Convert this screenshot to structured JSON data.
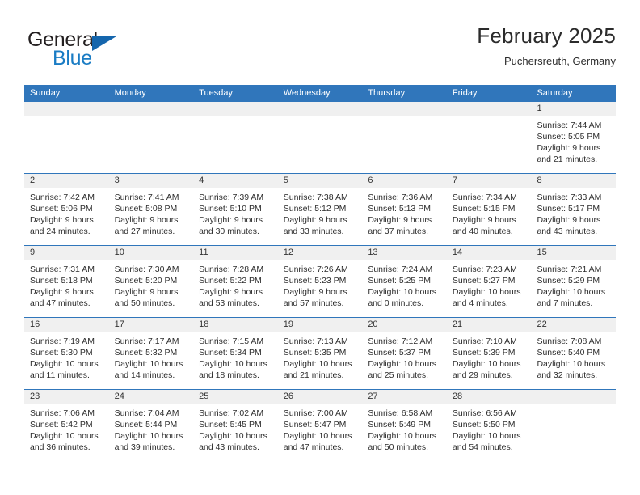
{
  "branding": {
    "name_part1": "General",
    "name_part2": "Blue",
    "triangle_icon": "brand-triangle-icon",
    "colors": {
      "dark": "#231f20",
      "blue": "#1a7cc4",
      "triangle": "#1566ad"
    }
  },
  "header": {
    "title": "February 2025",
    "subtitle": "Puchersreuth, Germany"
  },
  "theme": {
    "header_bg": "#3076bb",
    "header_text": "#ffffff",
    "day_band_bg": "#f0f0f0",
    "cell_bg": "#ffffff",
    "row_divider": "#3076bb"
  },
  "calendar": {
    "weekdays": [
      "Sunday",
      "Monday",
      "Tuesday",
      "Wednesday",
      "Thursday",
      "Friday",
      "Saturday"
    ],
    "weeks": [
      [
        {
          "day": "",
          "empty": true,
          "lines": []
        },
        {
          "day": "",
          "empty": true,
          "lines": []
        },
        {
          "day": "",
          "empty": true,
          "lines": []
        },
        {
          "day": "",
          "empty": true,
          "lines": []
        },
        {
          "day": "",
          "empty": true,
          "lines": []
        },
        {
          "day": "",
          "empty": true,
          "lines": []
        },
        {
          "day": "1",
          "empty": false,
          "lines": [
            "Sunrise: 7:44 AM",
            "Sunset: 5:05 PM",
            "Daylight: 9 hours",
            "and 21 minutes."
          ]
        }
      ],
      [
        {
          "day": "2",
          "empty": false,
          "lines": [
            "Sunrise: 7:42 AM",
            "Sunset: 5:06 PM",
            "Daylight: 9 hours",
            "and 24 minutes."
          ]
        },
        {
          "day": "3",
          "empty": false,
          "lines": [
            "Sunrise: 7:41 AM",
            "Sunset: 5:08 PM",
            "Daylight: 9 hours",
            "and 27 minutes."
          ]
        },
        {
          "day": "4",
          "empty": false,
          "lines": [
            "Sunrise: 7:39 AM",
            "Sunset: 5:10 PM",
            "Daylight: 9 hours",
            "and 30 minutes."
          ]
        },
        {
          "day": "5",
          "empty": false,
          "lines": [
            "Sunrise: 7:38 AM",
            "Sunset: 5:12 PM",
            "Daylight: 9 hours",
            "and 33 minutes."
          ]
        },
        {
          "day": "6",
          "empty": false,
          "lines": [
            "Sunrise: 7:36 AM",
            "Sunset: 5:13 PM",
            "Daylight: 9 hours",
            "and 37 minutes."
          ]
        },
        {
          "day": "7",
          "empty": false,
          "lines": [
            "Sunrise: 7:34 AM",
            "Sunset: 5:15 PM",
            "Daylight: 9 hours",
            "and 40 minutes."
          ]
        },
        {
          "day": "8",
          "empty": false,
          "lines": [
            "Sunrise: 7:33 AM",
            "Sunset: 5:17 PM",
            "Daylight: 9 hours",
            "and 43 minutes."
          ]
        }
      ],
      [
        {
          "day": "9",
          "empty": false,
          "lines": [
            "Sunrise: 7:31 AM",
            "Sunset: 5:18 PM",
            "Daylight: 9 hours",
            "and 47 minutes."
          ]
        },
        {
          "day": "10",
          "empty": false,
          "lines": [
            "Sunrise: 7:30 AM",
            "Sunset: 5:20 PM",
            "Daylight: 9 hours",
            "and 50 minutes."
          ]
        },
        {
          "day": "11",
          "empty": false,
          "lines": [
            "Sunrise: 7:28 AM",
            "Sunset: 5:22 PM",
            "Daylight: 9 hours",
            "and 53 minutes."
          ]
        },
        {
          "day": "12",
          "empty": false,
          "lines": [
            "Sunrise: 7:26 AM",
            "Sunset: 5:23 PM",
            "Daylight: 9 hours",
            "and 57 minutes."
          ]
        },
        {
          "day": "13",
          "empty": false,
          "lines": [
            "Sunrise: 7:24 AM",
            "Sunset: 5:25 PM",
            "Daylight: 10 hours",
            "and 0 minutes."
          ]
        },
        {
          "day": "14",
          "empty": false,
          "lines": [
            "Sunrise: 7:23 AM",
            "Sunset: 5:27 PM",
            "Daylight: 10 hours",
            "and 4 minutes."
          ]
        },
        {
          "day": "15",
          "empty": false,
          "lines": [
            "Sunrise: 7:21 AM",
            "Sunset: 5:29 PM",
            "Daylight: 10 hours",
            "and 7 minutes."
          ]
        }
      ],
      [
        {
          "day": "16",
          "empty": false,
          "lines": [
            "Sunrise: 7:19 AM",
            "Sunset: 5:30 PM",
            "Daylight: 10 hours",
            "and 11 minutes."
          ]
        },
        {
          "day": "17",
          "empty": false,
          "lines": [
            "Sunrise: 7:17 AM",
            "Sunset: 5:32 PM",
            "Daylight: 10 hours",
            "and 14 minutes."
          ]
        },
        {
          "day": "18",
          "empty": false,
          "lines": [
            "Sunrise: 7:15 AM",
            "Sunset: 5:34 PM",
            "Daylight: 10 hours",
            "and 18 minutes."
          ]
        },
        {
          "day": "19",
          "empty": false,
          "lines": [
            "Sunrise: 7:13 AM",
            "Sunset: 5:35 PM",
            "Daylight: 10 hours",
            "and 21 minutes."
          ]
        },
        {
          "day": "20",
          "empty": false,
          "lines": [
            "Sunrise: 7:12 AM",
            "Sunset: 5:37 PM",
            "Daylight: 10 hours",
            "and 25 minutes."
          ]
        },
        {
          "day": "21",
          "empty": false,
          "lines": [
            "Sunrise: 7:10 AM",
            "Sunset: 5:39 PM",
            "Daylight: 10 hours",
            "and 29 minutes."
          ]
        },
        {
          "day": "22",
          "empty": false,
          "lines": [
            "Sunrise: 7:08 AM",
            "Sunset: 5:40 PM",
            "Daylight: 10 hours",
            "and 32 minutes."
          ]
        }
      ],
      [
        {
          "day": "23",
          "empty": false,
          "lines": [
            "Sunrise: 7:06 AM",
            "Sunset: 5:42 PM",
            "Daylight: 10 hours",
            "and 36 minutes."
          ]
        },
        {
          "day": "24",
          "empty": false,
          "lines": [
            "Sunrise: 7:04 AM",
            "Sunset: 5:44 PM",
            "Daylight: 10 hours",
            "and 39 minutes."
          ]
        },
        {
          "day": "25",
          "empty": false,
          "lines": [
            "Sunrise: 7:02 AM",
            "Sunset: 5:45 PM",
            "Daylight: 10 hours",
            "and 43 minutes."
          ]
        },
        {
          "day": "26",
          "empty": false,
          "lines": [
            "Sunrise: 7:00 AM",
            "Sunset: 5:47 PM",
            "Daylight: 10 hours",
            "and 47 minutes."
          ]
        },
        {
          "day": "27",
          "empty": false,
          "lines": [
            "Sunrise: 6:58 AM",
            "Sunset: 5:49 PM",
            "Daylight: 10 hours",
            "and 50 minutes."
          ]
        },
        {
          "day": "28",
          "empty": false,
          "lines": [
            "Sunrise: 6:56 AM",
            "Sunset: 5:50 PM",
            "Daylight: 10 hours",
            "and 54 minutes."
          ]
        },
        {
          "day": "",
          "empty": true,
          "lines": []
        }
      ]
    ]
  }
}
